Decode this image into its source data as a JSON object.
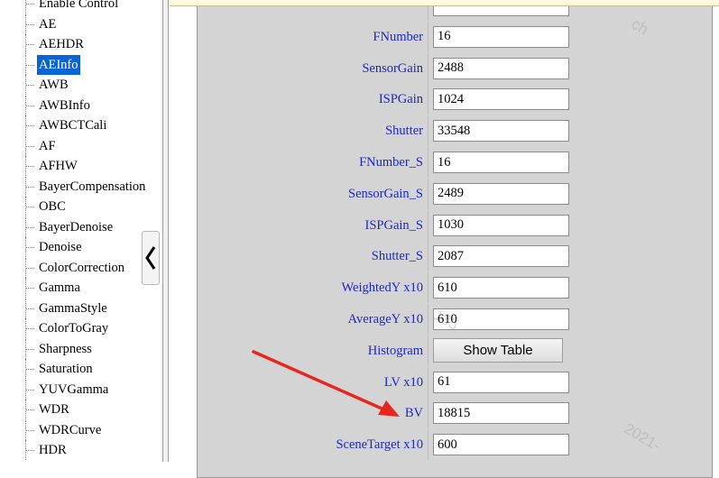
{
  "tree": {
    "items": [
      {
        "label": "Enable Control",
        "selected": false
      },
      {
        "label": "AE",
        "selected": false
      },
      {
        "label": "AEHDR",
        "selected": false
      },
      {
        "label": "AEInfo",
        "selected": true
      },
      {
        "label": "AWB",
        "selected": false
      },
      {
        "label": "AWBInfo",
        "selected": false
      },
      {
        "label": "AWBCTCali",
        "selected": false
      },
      {
        "label": "AF",
        "selected": false
      },
      {
        "label": "AFHW",
        "selected": false
      },
      {
        "label": "BayerCompensation",
        "selected": false
      },
      {
        "label": "OBC",
        "selected": false
      },
      {
        "label": "BayerDenoise",
        "selected": false
      },
      {
        "label": "Denoise",
        "selected": false
      },
      {
        "label": "ColorCorrection",
        "selected": false
      },
      {
        "label": "Gamma",
        "selected": false
      },
      {
        "label": "GammaStyle",
        "selected": false
      },
      {
        "label": "ColorToGray",
        "selected": false
      },
      {
        "label": "Sharpness",
        "selected": false
      },
      {
        "label": "Saturation",
        "selected": false
      },
      {
        "label": "YUVGamma",
        "selected": false
      },
      {
        "label": "WDR",
        "selected": false
      },
      {
        "label": "WDRCurve",
        "selected": false
      },
      {
        "label": "HDR",
        "selected": false
      }
    ]
  },
  "collapse_icon": "chevron-left-icon",
  "form": {
    "rows": [
      {
        "label": "",
        "value": "",
        "type": "input"
      },
      {
        "label": "FNumber",
        "value": "16",
        "type": "input"
      },
      {
        "label": "SensorGain",
        "value": "2488",
        "type": "input"
      },
      {
        "label": "ISPGain",
        "value": "1024",
        "type": "input"
      },
      {
        "label": "Shutter",
        "value": "33548",
        "type": "input"
      },
      {
        "label": "FNumber_S",
        "value": "16",
        "type": "input"
      },
      {
        "label": "SensorGain_S",
        "value": "2489",
        "type": "input"
      },
      {
        "label": "ISPGain_S",
        "value": "1030",
        "type": "input"
      },
      {
        "label": "Shutter_S",
        "value": "2087",
        "type": "input"
      },
      {
        "label": "WeightedY x10",
        "value": "610",
        "type": "input"
      },
      {
        "label": "AverageY x10",
        "value": "610",
        "type": "input"
      },
      {
        "label": "Histogram",
        "value": "Show Table",
        "type": "button"
      },
      {
        "label": "LV x10",
        "value": "61",
        "type": "input"
      },
      {
        "label": "BV",
        "value": "18815",
        "type": "input"
      },
      {
        "label": "SceneTarget x10",
        "value": "600",
        "type": "input"
      }
    ]
  },
  "colors": {
    "label_blue": "#1a28c8",
    "selected_bg": "#0a64d6",
    "panel_gray": "#d4d4d4",
    "arrow_red": "#e8261e"
  }
}
